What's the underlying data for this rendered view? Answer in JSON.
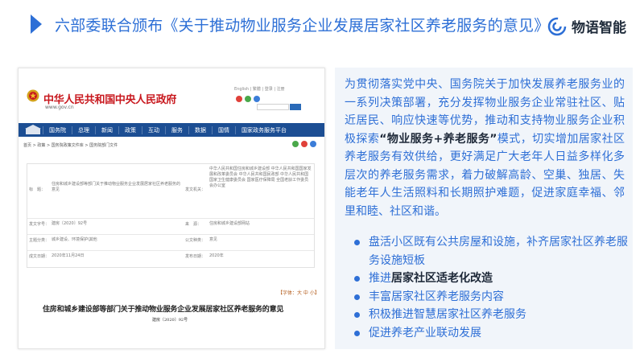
{
  "header": {
    "title": "六部委联合颁布《关于推动物业服务企业发展居家社区养老服务的意见》",
    "brand_name": "物语智能"
  },
  "gov_site": {
    "site_name": "中华人民共和国中央人民政府",
    "url": "www.gov.cn",
    "top_links": "English | 繁體 | 登录 | 注册",
    "nav_items": [
      "国务院",
      "总理",
      "新闻",
      "政策",
      "互动",
      "服务",
      "数据",
      "国情",
      "国家政务服务平台"
    ],
    "breadcrumb": "首页 > 政策 > 国务院政策文件库 > 国务院部门文件",
    "meta": {
      "title_label": "标　题：",
      "title_value": "住房和城乡建设部等部门关于推动物业服务企业发展居家社区养老服务的意见",
      "issuer_label": "发文机关：",
      "issuer_value": "中华人民共和国住房和城乡建设部 中华人民共和国国家发展和改革委员会 中华人民共和国民政部 中华人民共和国国家卫生健康委员会 国家医疗保障局 全国老龄工作委员会办公室",
      "docnum_label": "发文字号：",
      "docnum_value": "建房〔2020〕92号",
      "source_label": "来　源：",
      "source_value": "住房和城乡建设部网站",
      "topic_label": "主题分类：",
      "topic_value": "城乡建设、环境保护\\其他",
      "type_label": "公文种类：",
      "type_value": "意见",
      "date_label": "成文日期：",
      "date_value": "2020年11月24日",
      "pub_label": "发布日期：",
      "pub_value": "2020年"
    },
    "font_size_ctl": "【字体：大 中 小】",
    "doc_title": "住房和城乡建设部等部门关于推动物业服务企业发展居家社区养老服务的意见",
    "doc_number": "建房〔2020〕92号"
  },
  "summary": {
    "part1": "为贯彻落实党中央、国务院关于加快发展养老服务业的一系列决策部署，充分发挥物业服务企业常驻社区、贴近居民、响应快速等优势，推动和支持物业服务企业积极探索",
    "highlight": "“物业服务+养老服务”",
    "part2": "模式，切实增加居家社区养老服务有效供给，更好满足广大老年人日益多样化多层次的养老服务需求，着力破解高龄、空巢、独居、失能老年人生活照料和长期照护难题，促进家庭幸福、邻里和睦、社区和谐。"
  },
  "bullets": [
    {
      "pre": "盘活小区既有公共房屋和设施，补齐居家社区养老服务设施短板",
      "bold": "",
      "post": ""
    },
    {
      "pre": "推进",
      "bold": "居家社区适老化改造",
      "post": ""
    },
    {
      "pre": "丰富居家社区养老服务内容",
      "bold": "",
      "post": ""
    },
    {
      "pre": "积极推进智慧居家社区养老服务",
      "bold": "",
      "post": ""
    },
    {
      "pre": "促进养老产业联动发展",
      "bold": "",
      "post": ""
    }
  ],
  "colors": {
    "accent": "#2d6fd6",
    "gov_red": "#c8181e",
    "gov_nav": "#1c4e93",
    "panel_bg": "#f1f5fa"
  }
}
